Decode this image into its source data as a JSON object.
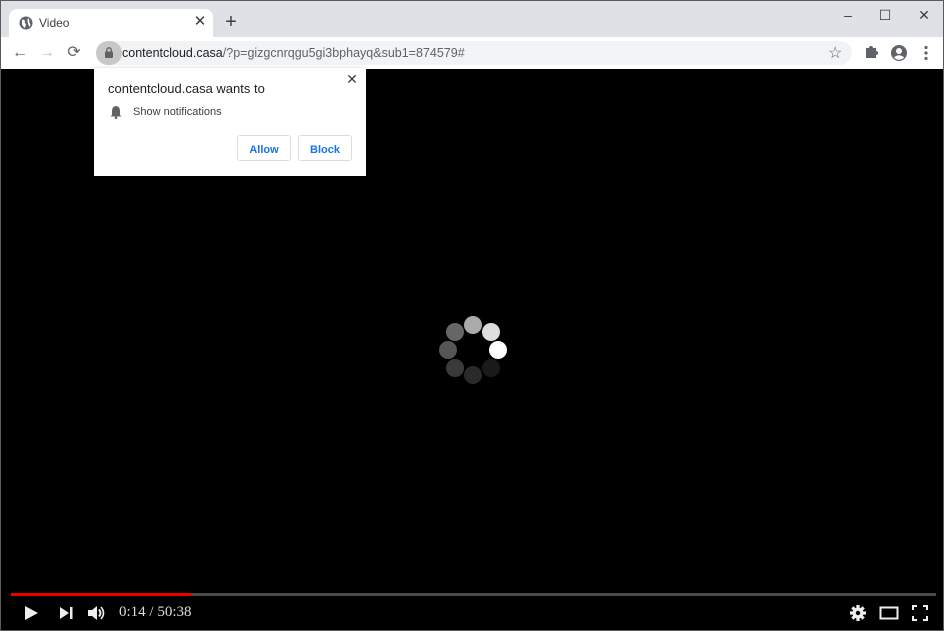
{
  "browser": {
    "tab": {
      "title": "Video",
      "icon": "globe-icon"
    },
    "new_tab_label": "+",
    "window_controls": {
      "minimize": "–",
      "maximize": "☐",
      "close": "✕"
    },
    "nav": {
      "back": "←",
      "forward": "→",
      "reload": "⟳"
    },
    "url": {
      "host": "contentcloud.casa",
      "rest": "/?p=gizgcnrqgu5gi3bphayq&sub1=874579#"
    },
    "toolbar_icons": [
      "star-icon",
      "extensions-icon",
      "profile-icon",
      "menu-icon"
    ]
  },
  "permission_prompt": {
    "title": "contentcloud.casa wants to",
    "permission": "Show notifications",
    "allow_label": "Allow",
    "block_label": "Block",
    "close_label": "✕"
  },
  "player": {
    "current_time": "0:14",
    "duration": "50:38",
    "time_display": "0:14 / 50:38",
    "progress_fraction": 0.195,
    "state": "loading",
    "progress_color": "#ee0000"
  }
}
